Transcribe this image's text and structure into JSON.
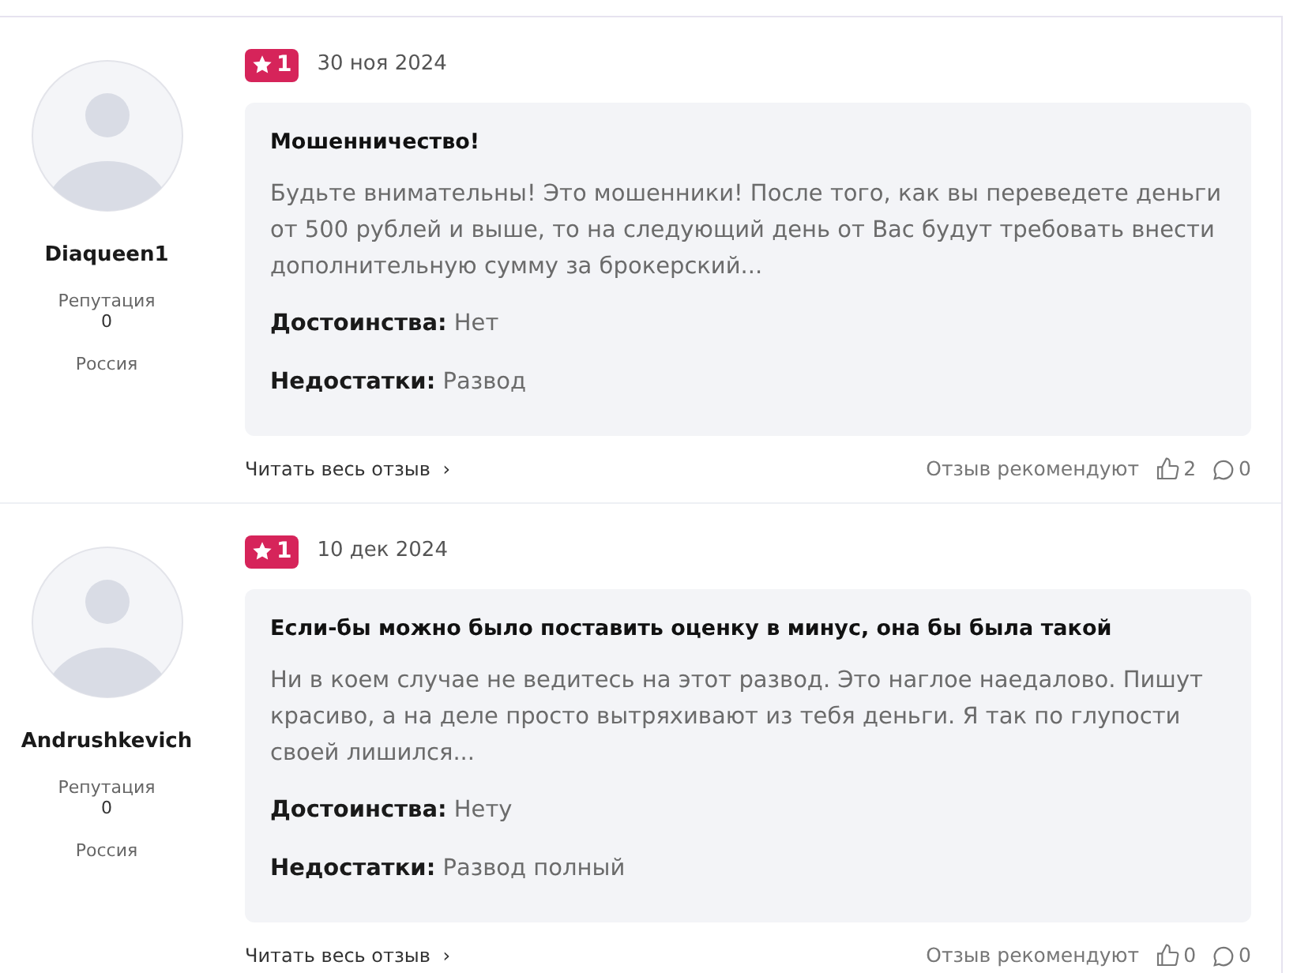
{
  "reviews": [
    {
      "author": {
        "name": "Diaqueen1",
        "reputation_label": "Репутация",
        "reputation": "0",
        "country": "Россия"
      },
      "rating": "1",
      "date": "30 ноя 2024",
      "title": "Мошенничество!",
      "text": "Будьте внимательны! Это мошенники! После того, как вы переведете деньги от 500 рублей и выше, то на следующий день от Вас будут требовать внести дополнительную сумму за брокерский...",
      "pros_label": "Достоинства:",
      "pros": "Нет",
      "cons_label": "Недостатки:",
      "cons": "Развод",
      "read_more": "Читать весь отзыв",
      "caret": "›",
      "recommend_label": "Отзыв рекомендуют",
      "likes": "2",
      "comments": "0"
    },
    {
      "author": {
        "name": "Andrushkevich",
        "reputation_label": "Репутация",
        "reputation": "0",
        "country": "Россия"
      },
      "rating": "1",
      "date": "10 дек 2024",
      "title": "Если-бы можно было поставить оценку в минус, она бы была такой",
      "text": "Ни в коем случае не ведитесь на этот развод. Это наглое наедалово. Пишут красиво, а на деле просто вытряхивают из тебя деньги. Я так по глупости своей лишился...",
      "pros_label": "Достоинства:",
      "pros": "Нету",
      "cons_label": "Недостатки:",
      "cons": "Развод полный",
      "read_more": "Читать весь отзыв",
      "caret": "›",
      "recommend_label": "Отзыв рекомендуют",
      "likes": "0",
      "comments": "0"
    }
  ]
}
